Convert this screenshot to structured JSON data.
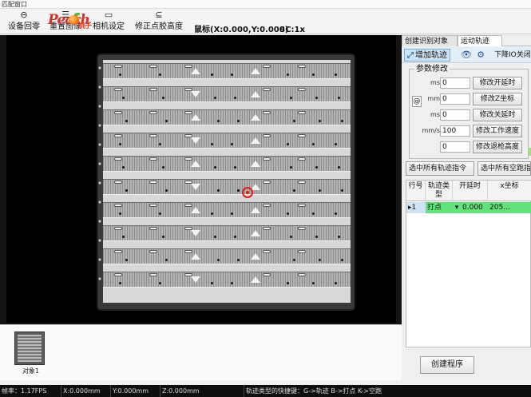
{
  "window_title": "匹配窗口",
  "toolbar": {
    "buttons": [
      {
        "label": "设备回零",
        "icon": "return-zero-icon"
      },
      {
        "label": "重置图像",
        "icon": "reset-image-icon"
      },
      {
        "label": "相机设定",
        "icon": "camera-icon"
      },
      {
        "label": "修正点胶高度",
        "icon": "glue-height-icon"
      }
    ],
    "logo_text": "Peach",
    "logo_cn": "桃子",
    "mouse_label": "鼠标(X:0.000,Y:0.000)",
    "scale_label": "SC:1x"
  },
  "thumbnails": [
    {
      "label": "对象1"
    }
  ],
  "statusbar": {
    "fps": "帧率：1.17FPS",
    "x": "X:0.000mm",
    "y": "Y:0.000mm",
    "z": "Z:0.000mm",
    "shortcut_hint": "轨迹类型的快捷键：G->轨迹  B->打点  K->空跑"
  },
  "right_panel": {
    "tabs": [
      {
        "label": "创建识别对象",
        "active": false
      },
      {
        "label": "运动轨迹",
        "active": true
      }
    ],
    "add_track_label": "增加轨迹",
    "io_label": "下降IO关闭",
    "param_group_title": "参数修改",
    "param_rows": [
      {
        "unit": "ms",
        "value": "0",
        "button": "修改开延时"
      },
      {
        "unit": "mm",
        "value": "0",
        "button": "修改Z坐标"
      },
      {
        "unit": "ms",
        "value": "0",
        "button": "修改关延时"
      },
      {
        "unit": "mm/s",
        "value": "100",
        "button": "修改工作速度"
      },
      {
        "unit": "",
        "value": "0",
        "button": "修改退枪高度"
      }
    ],
    "at_symbol": "@",
    "select_all_tracks": "选中所有轨迹指令",
    "select_all_dry_run": "选中所有空跑指令",
    "table": {
      "headers": [
        "行号",
        "轨迹类型",
        "开延时",
        "x坐标"
      ],
      "rows": [
        {
          "row": "1",
          "type": "打点",
          "delay": "0.000",
          "x": "205..."
        }
      ]
    },
    "create_program": "创建程序"
  },
  "colors": {
    "accent": "#63e27c",
    "crosshair": "#e01a1a",
    "logo": "#d4302b"
  }
}
